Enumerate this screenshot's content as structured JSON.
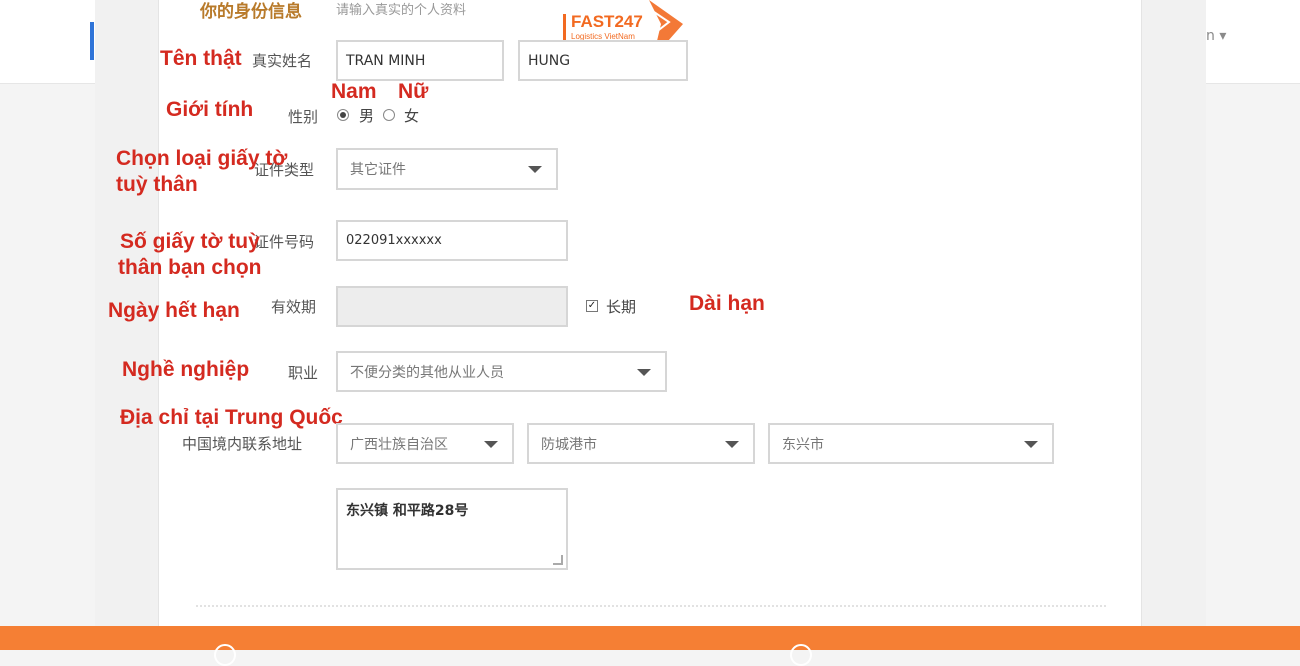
{
  "page": {
    "title": "你的身份信息",
    "subtitle": "请输入真实的个人资料"
  },
  "background": {
    "user_menu": "n ▾"
  },
  "logo": {
    "brand": "FAST247",
    "tagline": "Logistics VietNam"
  },
  "form": {
    "name": {
      "label": "真实姓名",
      "annotation": "Tên thật",
      "first_value": "TRAN MINH",
      "last_value": "HUNG"
    },
    "gender": {
      "label": "性别",
      "annotation": "Giới tính",
      "male_label": "男",
      "female_label": "女",
      "male_annotation": "Nam",
      "female_annotation": "Nữ",
      "selected": "男"
    },
    "id_type": {
      "label": "证件类型",
      "annotation_line1": "Chọn loại giấy tờ",
      "annotation_line2": "tuỳ thân",
      "value": "其它证件"
    },
    "id_number": {
      "label": "证件号码",
      "annotation_line1": "Số giấy tờ tuỳ",
      "annotation_line2": "thân bạn chọn",
      "value": "022091xxxxxx"
    },
    "expiry": {
      "label": "有效期",
      "annotation": "Ngày hết hạn",
      "value": "",
      "long_term_label": "长期",
      "long_term_checked": true,
      "long_term_annotation": "Dài hạn"
    },
    "occupation": {
      "label": "职业",
      "annotation": "Nghề nghiệp",
      "value": "不便分类的其他从业人员"
    },
    "address": {
      "label": "中国境内联系地址",
      "annotation": "Địa chỉ tại Trung Quốc",
      "province": "广西壮族自治区",
      "city": "防城港市",
      "district": "东兴市",
      "detail": "东兴镇 和平路28号"
    }
  },
  "colors": {
    "annotation": "#d42a20",
    "brand_orange": "#f26a21",
    "footer": "#f57f34",
    "title": "#b87a2a"
  }
}
